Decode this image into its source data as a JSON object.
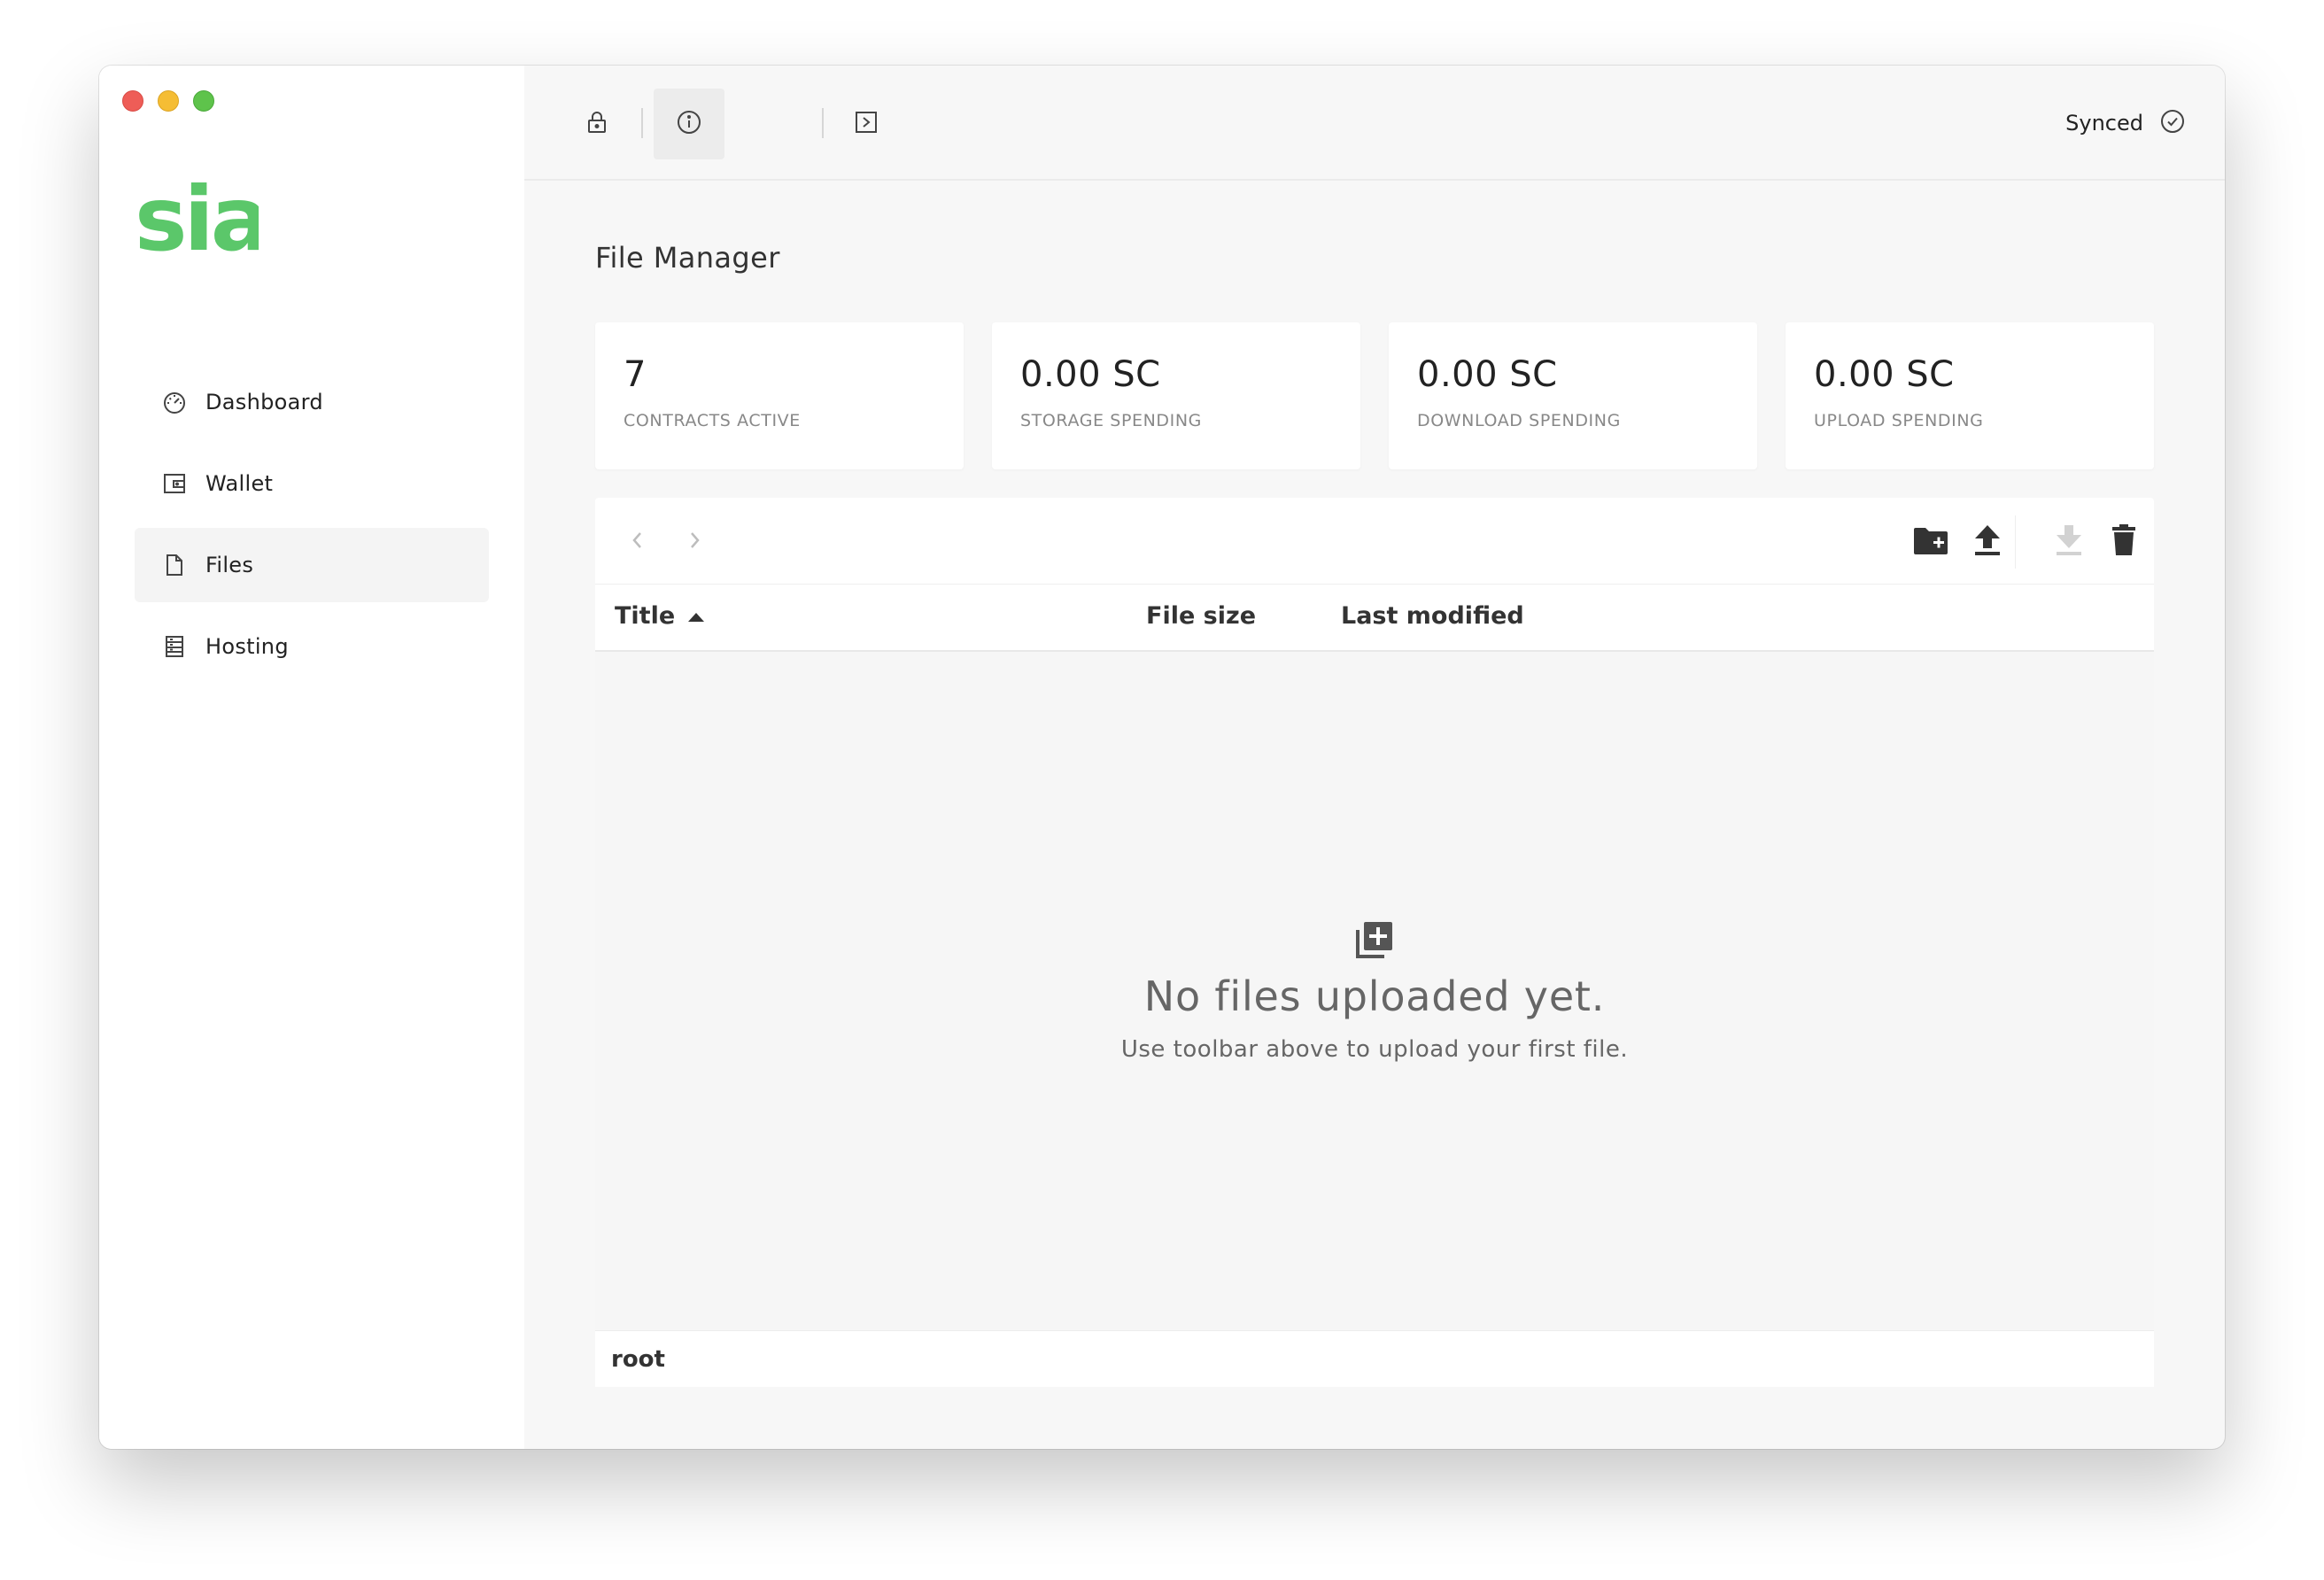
{
  "app": {
    "logo_text": "sia",
    "brand_color": "#5bc76a"
  },
  "sidebar": {
    "items": [
      {
        "label": "Dashboard",
        "icon": "dashboard-icon",
        "active": false
      },
      {
        "label": "Wallet",
        "icon": "wallet-icon",
        "active": false
      },
      {
        "label": "Files",
        "icon": "file-icon",
        "active": true
      },
      {
        "label": "Hosting",
        "icon": "hosting-icon",
        "active": false
      }
    ]
  },
  "topbar": {
    "buttons": [
      "lock-icon",
      "info-icon",
      "terminal-icon"
    ],
    "active_button": "info-icon",
    "status_label": "Synced",
    "status_icon": "check-circle-icon"
  },
  "page": {
    "title": "File Manager"
  },
  "stats": [
    {
      "value": "7",
      "label": "CONTRACTS ACTIVE"
    },
    {
      "value": "0.00 SC",
      "label": "STORAGE SPENDING"
    },
    {
      "value": "0.00 SC",
      "label": "DOWNLOAD SPENDING"
    },
    {
      "value": "0.00 SC",
      "label": "UPLOAD SPENDING"
    }
  ],
  "files": {
    "toolbar": {
      "left": [
        "back-arrow-icon",
        "forward-arrow-icon"
      ],
      "right": [
        "new-folder-icon",
        "upload-icon",
        "download-icon",
        "delete-icon"
      ]
    },
    "columns": {
      "title": "Title",
      "size": "File size",
      "modified": "Last modified"
    },
    "sort": {
      "column": "title",
      "direction": "ascending"
    },
    "empty": {
      "title": "No files uploaded yet.",
      "subtitle": "Use toolbar above to upload your first file."
    },
    "path": [
      "root"
    ]
  }
}
